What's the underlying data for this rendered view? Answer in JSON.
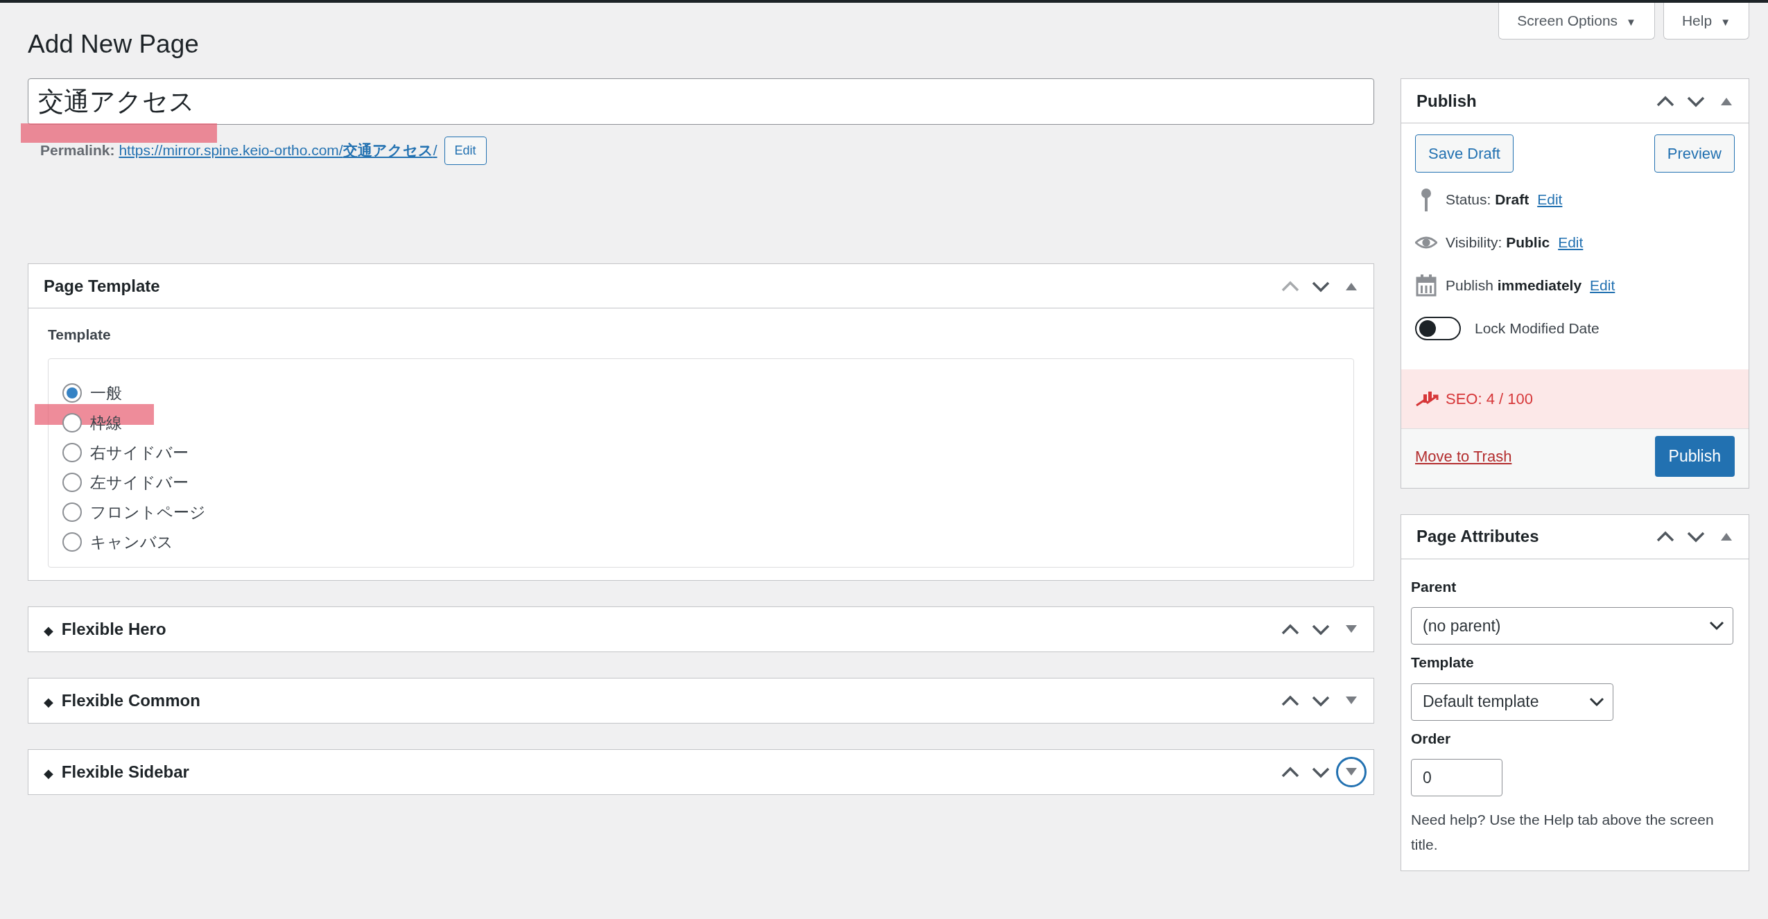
{
  "header_buttons": [
    {
      "label": "Screen Options",
      "caret": "▼"
    },
    {
      "label": "Help",
      "caret": "▼"
    }
  ],
  "page_title": "Add New Page",
  "title_field": {
    "value": "交通アクセス"
  },
  "permalink": {
    "label": "Permalink:",
    "url": "https://mirror.spine.keio-ortho.com/**交通アクセス**/",
    "button": "Edit"
  },
  "main_boxes": [
    {
      "kind": "template",
      "title": "Page Template",
      "expanded": true,
      "up_disabled": true,
      "toggle_focused": false,
      "field_label": "Template",
      "options": [
        {
          "label": "一般",
          "selected": true
        },
        {
          "label": "枠線",
          "selected": false
        },
        {
          "label": "右サイドバー",
          "selected": false
        },
        {
          "label": "左サイドバー",
          "selected": false
        },
        {
          "label": "フロントページ",
          "selected": false
        },
        {
          "label": "キャンバス",
          "selected": false
        }
      ]
    },
    {
      "kind": "flexible",
      "bullet": "◆",
      "title": "Flexible Hero",
      "expanded": false,
      "up_disabled": false,
      "toggle_focused": false
    },
    {
      "kind": "flexible",
      "bullet": "◆",
      "title": "Flexible Common",
      "expanded": false,
      "up_disabled": false,
      "toggle_focused": false
    },
    {
      "kind": "flexible",
      "bullet": "◆",
      "title": "Flexible Sidebar",
      "expanded": false,
      "up_disabled": false,
      "toggle_focused": true
    }
  ],
  "publish": {
    "title": "Publish",
    "expanded": true,
    "save_draft": "Save Draft",
    "preview": "Preview",
    "rows": [
      {
        "kind": "status",
        "text": "Status: **Draft**",
        "link": "Edit"
      },
      {
        "kind": "visibility",
        "text": "Visibility: **Public**",
        "link": "Edit"
      },
      {
        "kind": "schedule",
        "text": "Publish **immediately**",
        "link": "Edit"
      }
    ],
    "lock_toggle": {
      "label": "Lock Modified Date",
      "on": false
    },
    "seo": {
      "text": "SEO: 4 / 100"
    },
    "trash": "Move to Trash",
    "publish_button": "Publish"
  },
  "page_attributes": {
    "title": "Page Attributes",
    "expanded": true,
    "fields": [
      {
        "kind": "select",
        "label": "Parent",
        "value": "(no parent)",
        "wide": true
      },
      {
        "kind": "select",
        "label": "Template",
        "value": "Default template",
        "wide": false
      },
      {
        "kind": "number",
        "label": "Order",
        "value": "0"
      }
    ],
    "help": "Need help? Use the Help tab above the screen title."
  }
}
